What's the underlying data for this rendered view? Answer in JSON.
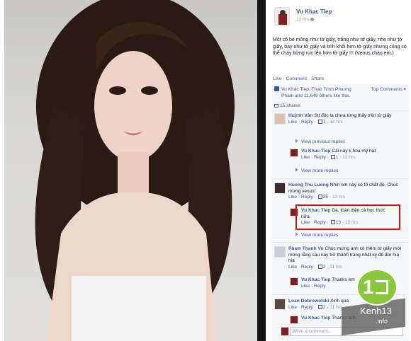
{
  "post": {
    "author": "Vu Khac Tiep",
    "time": "13 hrs",
    "text": "Một cô bé mông như tờ giấy, trắng như tờ giấy, nhẹ như tờ giấy, bay như tờ giấy và tinh khôi hơn tờ giấy nhưng cũng có thể cháy bừng rực lên hơn tờ giấy !!! (Venus chào em.)",
    "sign": "",
    "actions": {
      "like": "Like",
      "comment": "Comment",
      "share": "Share"
    },
    "likes_text": "Vu Khac Tiep, Thao Trinh Phuong Pham and 11,648 others like this.",
    "top_comments": "Top Comments ▾",
    "shares": "15 shares"
  },
  "comments": [
    {
      "name": "Huỳnh Vân",
      "text": "Stt độc lạ chưa từng thấy trên tờ giấy",
      "like": "Like",
      "reply": "Reply",
      "likes": "7",
      "time": "12 hrs"
    },
    {
      "name": "Vu Khac Tiep",
      "text": "Cái này k hoa mỹ hạt",
      "like": "Like",
      "reply": "Reply",
      "likes": "1",
      "time": "12 hrs"
    },
    {
      "name": "Huong Thu Luong",
      "text": "Nhìn em này có tố chất đó. Chúc mừng venus!",
      "like": "Like",
      "reply": "Reply",
      "likes": "35",
      "time": "13 hrs"
    },
    {
      "name": "Vu Khac Tiep",
      "text": "Dạ, toàn diện cả học thức nữa",
      "like": "Like",
      "reply": "Reply",
      "likes": "13",
      "time": "13 hrs"
    },
    {
      "name": "Pham Thanh Vu",
      "text": "Chúc mừng anh có thêm tờ giấy mới mong rằng sau này trở thành trang nhật ký để đời hia hia",
      "like": "Like",
      "reply": "Reply",
      "likes": "2",
      "time": "11 hrs"
    },
    {
      "name": "Vu Khac Tiep",
      "text": "Thanks em",
      "like": "Like",
      "reply": "Reply",
      "likes": "",
      "time": ""
    },
    {
      "name": "Loan Dobrowolski",
      "text": "Xinh quá",
      "like": "Like",
      "reply": "Reply",
      "likes": "2",
      "time": "11 hrs"
    },
    {
      "name": "Vu Khac Tiep",
      "text": "Thanks anh",
      "like": "",
      "reply": "",
      "likes": "",
      "time": ""
    }
  ],
  "view_previous": "View previous replies",
  "view_more_1": "View more replies",
  "view_more_2": "View more replies",
  "write_placeholder": "Write a comment...",
  "watermark": {
    "brand": "Kenh13",
    "sub": ".info"
  },
  "colors": {
    "link": "#3b5998",
    "highlight": "#d0141b",
    "watermark": "#8cc63f"
  }
}
